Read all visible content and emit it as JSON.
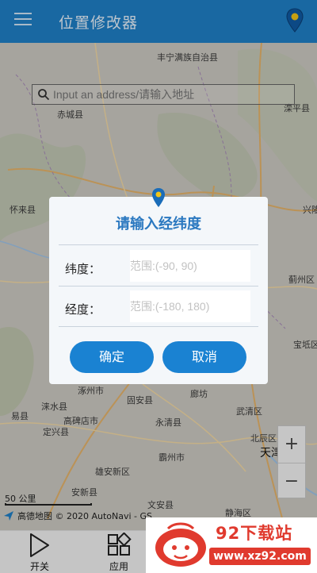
{
  "app_bar": {
    "title": "位置修改器"
  },
  "search": {
    "placeholder": "Input an address/请输入地址"
  },
  "map": {
    "labels": [
      {
        "text": "丰宁满族自治县"
      },
      {
        "text": "赤城县"
      },
      {
        "text": "滦平县"
      },
      {
        "text": "怀来县"
      },
      {
        "text": "兴隆"
      },
      {
        "text": "蓟州区"
      },
      {
        "text": "宝坻区"
      },
      {
        "text": "涿州市"
      },
      {
        "text": "固安县"
      },
      {
        "text": "廊坊"
      },
      {
        "text": "易县"
      },
      {
        "text": "涞水县"
      },
      {
        "text": "高碑店市"
      },
      {
        "text": "定兴县"
      },
      {
        "text": "永清县"
      },
      {
        "text": "武清区"
      },
      {
        "text": "北辰区"
      },
      {
        "text": "天津"
      },
      {
        "text": "霸州市"
      },
      {
        "text": "雄安新区"
      },
      {
        "text": "安新县"
      },
      {
        "text": "文安县"
      },
      {
        "text": "静海区"
      }
    ],
    "scale_text": "50 公里",
    "attribution": "高德地图 © 2020 AutoNavi - GS"
  },
  "dialog": {
    "title": "请输入经纬度",
    "latitude_label": "纬度：",
    "latitude_placeholder": "范围:(-90, 90)",
    "longitude_label": "经度：",
    "longitude_placeholder": "范围:(-180, 180)",
    "confirm_label": "确定",
    "cancel_label": "取消"
  },
  "zoom": {
    "in": "+",
    "out": "−"
  },
  "bottom_nav": [
    {
      "label": "开关"
    },
    {
      "label": "应用"
    }
  ],
  "watermark": {
    "title": "92下载站",
    "url": "www.xz92.com"
  },
  "colors": {
    "primary": "#1f7fc6",
    "button": "#1a82d2",
    "dialog_title": "#2a78c0",
    "watermark": "#e03a2e"
  }
}
